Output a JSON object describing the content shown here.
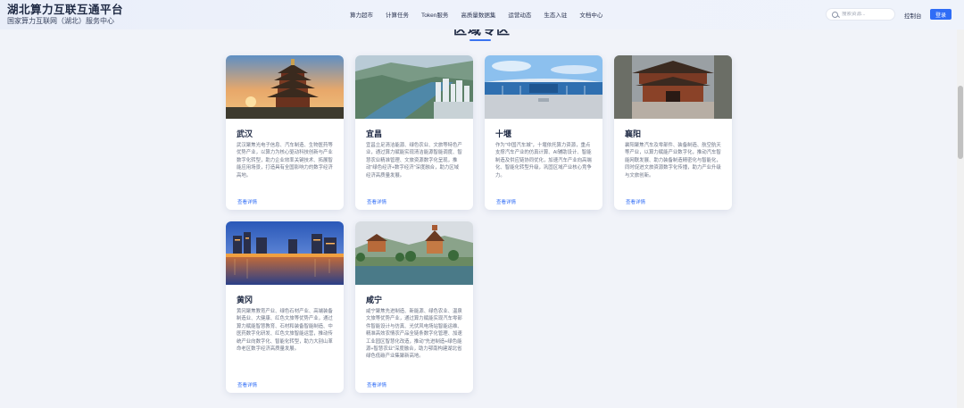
{
  "header": {
    "brand_title": "湖北算力互联互通平台",
    "brand_sub": "国家算力互联网（湖北）服务中心",
    "nav": [
      "算力超市",
      "计算任务",
      "Token服务",
      "高质量数据集",
      "运营动态",
      "生态入驻",
      "文档中心"
    ],
    "search_placeholder": "搜索资源...",
    "console_label": "控制台",
    "login_label": "登录"
  },
  "section": {
    "title": "区域专区"
  },
  "cards": [
    {
      "name": "武汉",
      "desc": "武汉聚焦光电子信息、汽车制造、生物医药等优势产业，以算力为核心驱动科技创新与产业数字化转型，助力企业效率关键技术、拓展智能应用场景，打造具有全国影响力的数字经济高地。",
      "link": "查看详情"
    },
    {
      "name": "宜昌",
      "desc": "宜昌立足清洁能源、绿色农业、文旅等特色产业，通过算力赋能实现清洁能源智能调度、智慧农业精准管理、文旅资源数字化呈现，推动\"绿色经济+数字经济\"深度融合，助力区域经济高质量发展。",
      "link": "查看详情"
    },
    {
      "name": "十堰",
      "desc": "作为\"中国汽车城\"，十堰依托算力资源，重点支撑汽车产业的仿真计算、AI辅助设计、智能制造及供应链协同优化，加速汽车产业向高端化、智能化转型升级，巩固区域产业核心竞争力。",
      "link": "查看详情"
    },
    {
      "name": "襄阳",
      "desc": "襄阳聚焦汽车及零部件、装备制造、航空航天等产业，以算力赋能产业数字化，推动汽车智能网联发展、助力装备制造精密化与智能化，同时促进文旅资源数字化传播，助力产业升级与文旅创新。",
      "link": "查看详情"
    },
    {
      "name": "黄冈",
      "desc": "黄冈聚焦教育产业、绿色石材产业、高端装备制造业、大健康、红色文旅等优势产业，通过算力赋能智慧教育、石材和装备智能制造、中医药数字化研发、红色文旅智能运营，推动传统产业向数字化、智能化转型，助力大别山革命老区数字经济高质量发展。",
      "link": "查看详情"
    },
    {
      "name": "咸宁",
      "desc": "咸宁聚焦先进制造、新能源、绿色农业、温泉文旅等优势产业，通过算力赋能实现汽车零部件智能设计与仿真、光伏风电场站智能运维、精准高效农情农产品全链条数字化管理、加速工业园区智慧化改造，推动\"先进制造+绿色能源+智慧农业\"深度融合，助力鄂南构建湖北省绿色低碳产业集聚新高地。",
      "link": "查看详情"
    }
  ]
}
